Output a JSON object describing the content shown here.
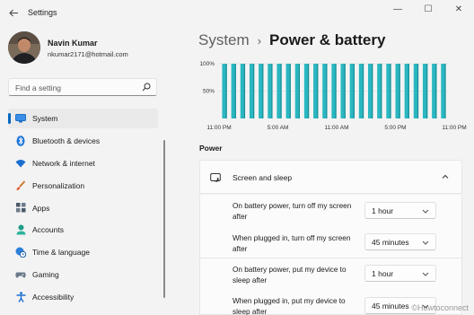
{
  "window": {
    "title": "Settings",
    "back_icon": "back-arrow-icon",
    "controls": {
      "minimize": "—",
      "maximize": "☐",
      "close": "✕"
    }
  },
  "profile": {
    "name": "Navin Kumar",
    "email": "nkumar2171@hotmail.com"
  },
  "search": {
    "placeholder": "Find a setting"
  },
  "sidebar": {
    "items": [
      {
        "label": "System",
        "icon": "monitor-icon",
        "active": true
      },
      {
        "label": "Bluetooth & devices",
        "icon": "bluetooth-icon"
      },
      {
        "label": "Network & internet",
        "icon": "wifi-icon"
      },
      {
        "label": "Personalization",
        "icon": "brush-icon"
      },
      {
        "label": "Apps",
        "icon": "apps-icon"
      },
      {
        "label": "Accounts",
        "icon": "person-icon"
      },
      {
        "label": "Time & language",
        "icon": "globe-clock-icon"
      },
      {
        "label": "Gaming",
        "icon": "controller-icon"
      },
      {
        "label": "Accessibility",
        "icon": "accessibility-icon"
      }
    ]
  },
  "breadcrumb": {
    "parent": "System",
    "separator": "›",
    "current": "Power & battery"
  },
  "chart_data": {
    "type": "bar",
    "yticks": [
      "100%",
      "50%"
    ],
    "xticks": [
      "11:00 PM",
      "5:00 AM",
      "11:00 AM",
      "5:00 PM",
      "11:00 PM"
    ],
    "values": [
      100,
      100,
      100,
      100,
      100,
      100,
      100,
      100,
      100,
      100,
      100,
      100,
      100,
      100,
      100,
      100,
      100,
      100,
      100,
      100,
      100,
      100,
      100,
      100,
      100
    ],
    "ylim": [
      0,
      100
    ],
    "color": "#2ab7c1",
    "gridlines": true
  },
  "power": {
    "section_title": "Power",
    "screen_sleep": {
      "label": "Screen and sleep",
      "rows": [
        {
          "label": "On battery power, turn off my screen after",
          "value": "1 hour"
        },
        {
          "label": "When plugged in, turn off my screen after",
          "value": "45 minutes"
        },
        {
          "label": "On battery power, put my device to sleep after",
          "value": "1 hour"
        },
        {
          "label": "When plugged in, put my device to sleep after",
          "value": "45 minutes"
        }
      ]
    }
  },
  "watermark": "©Howtoconnect"
}
